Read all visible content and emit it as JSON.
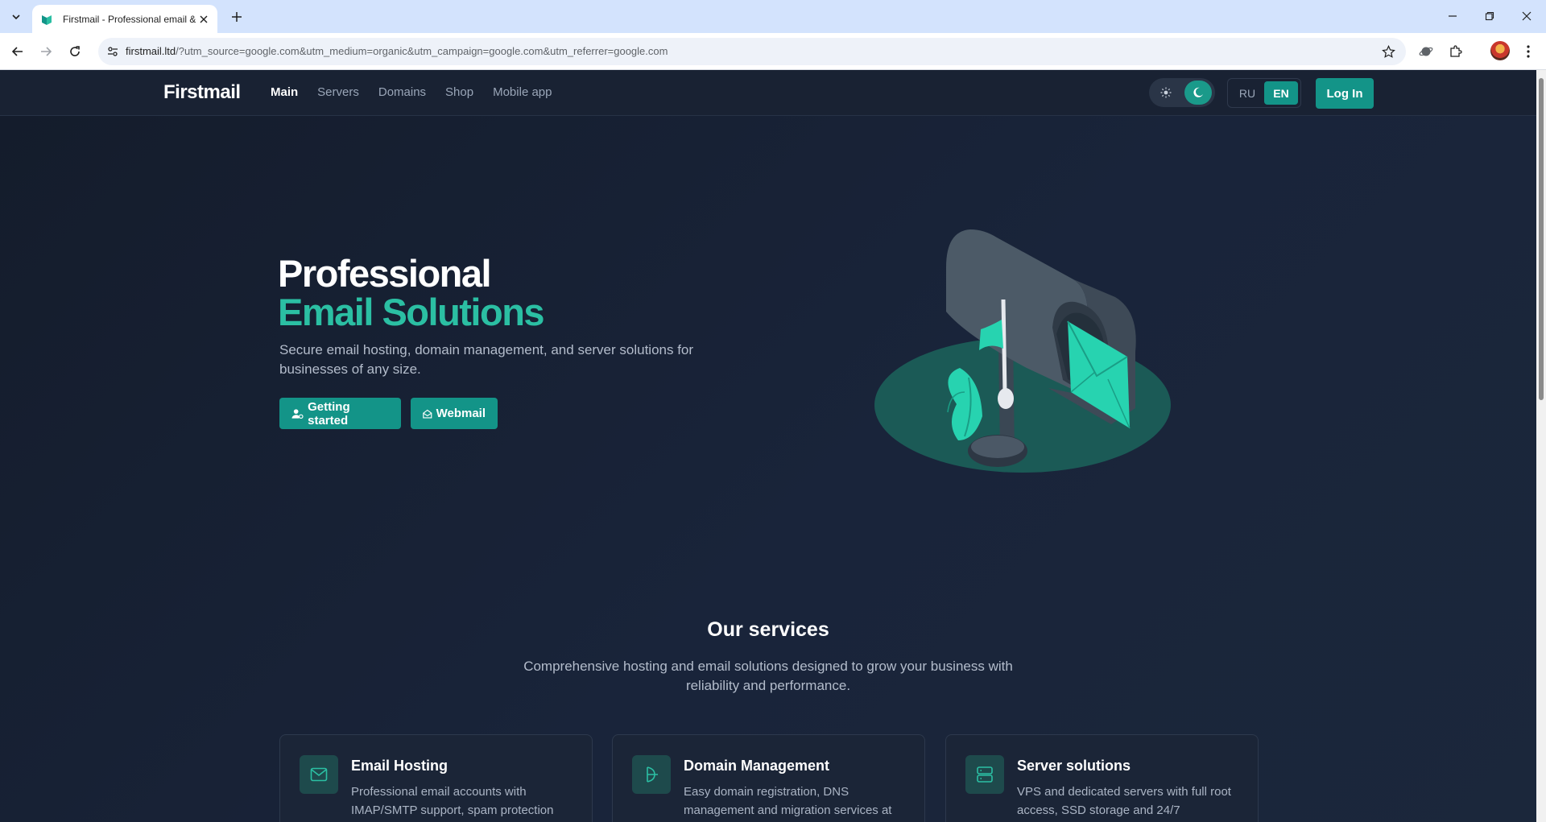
{
  "browser": {
    "tab_title": "Firstmail - Professional email &",
    "url_host": "firstmail.ltd",
    "url_rest": "/?utm_source=google.com&utm_medium=organic&utm_campaign=google.com&utm_referrer=google.com"
  },
  "header": {
    "logo": "Firstmail",
    "nav": [
      "Main",
      "Servers",
      "Domains",
      "Shop",
      "Mobile app"
    ],
    "lang": [
      "RU",
      "EN"
    ],
    "login": "Log In"
  },
  "hero": {
    "title_line1": "Professional",
    "title_line2": "Email Solutions",
    "subtitle": "Secure email hosting, domain management, and server solutions for businesses of any size.",
    "btn_start": "Getting started",
    "btn_webmail": "Webmail"
  },
  "services": {
    "title": "Our services",
    "subtitle": "Comprehensive hosting and email solutions designed to grow your business with reliability and performance.",
    "cards": [
      {
        "title": "Email Hosting",
        "text": "Professional email accounts with IMAP/SMTP support, spam protection",
        "icon": "mail-icon"
      },
      {
        "title": "Domain Management",
        "text": "Easy domain registration, DNS management and migration services at",
        "icon": "domain-icon"
      },
      {
        "title": "Server solutions",
        "text": "VPS and dedicated servers with full root access, SSD storage and 24/7",
        "icon": "server-icon"
      }
    ]
  },
  "colors": {
    "accent": "#139488",
    "accent_text": "#2bbfa3",
    "page_bg": "#141c2b"
  }
}
